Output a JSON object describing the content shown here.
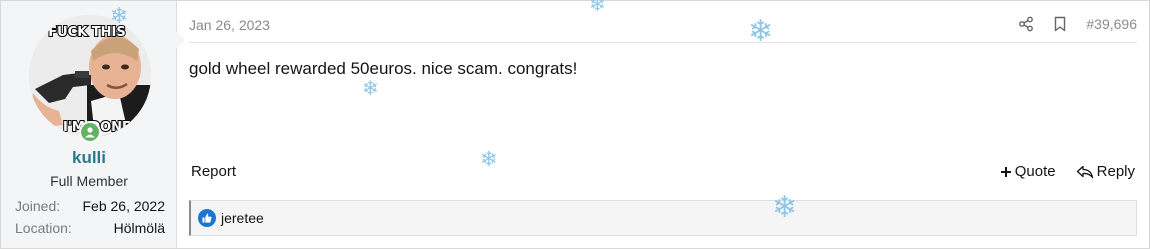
{
  "user": {
    "avatar_text_top": "FUCK THIS",
    "avatar_text_bottom": "I'M DONE",
    "name": "kulli",
    "title": "Full Member",
    "stats": [
      {
        "label": "Joined:",
        "value": "Feb 26, 2022"
      },
      {
        "label": "Location:",
        "value": "Hölmölä"
      }
    ]
  },
  "post": {
    "date": "Jan 26, 2023",
    "number": "#39,696",
    "message": "gold wheel rewarded 50euros. nice scam. congrats!",
    "report_label": "Report",
    "quote_label": "Quote",
    "reply_label": "Reply"
  },
  "reactions": {
    "users": "jeretee"
  },
  "icons": {
    "share": "share-icon",
    "bookmark": "bookmark-icon",
    "quote": "plus-icon",
    "reply": "reply-icon",
    "like": "like-icon",
    "decor": "snowflake-icon"
  },
  "colors": {
    "username": "#2a7a8c",
    "online": "#63b265",
    "like": "#1b76d2",
    "snow": "#8fc6e6"
  }
}
